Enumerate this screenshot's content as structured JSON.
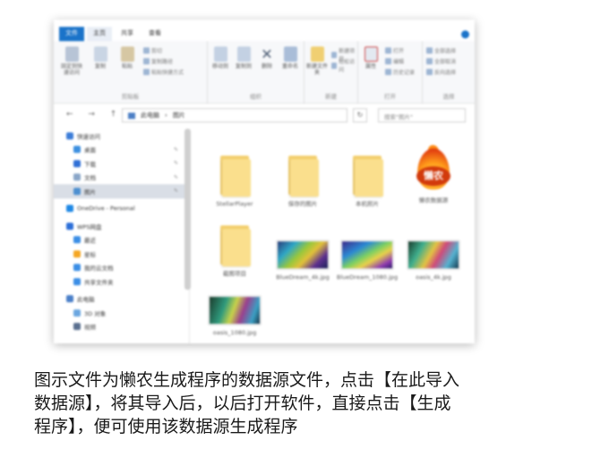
{
  "window": {
    "tabs": [
      "文件",
      "主页",
      "共享",
      "查看"
    ],
    "ribbon_groups": [
      {
        "label": "剪贴板",
        "buttons": [
          "固定到快速访问",
          "复制",
          "粘贴"
        ],
        "small": [
          "剪切",
          "复制路径",
          "粘贴快捷方式"
        ]
      },
      {
        "label": "组织",
        "buttons": [
          "移动到",
          "复制到",
          "删除",
          "重命名"
        ]
      },
      {
        "label": "新建",
        "buttons": [
          "新建文件夹"
        ],
        "small": [
          "新建项目",
          "轻松访问"
        ]
      },
      {
        "label": "打开",
        "buttons": [
          "属性"
        ],
        "small": [
          "打开",
          "编辑",
          "历史记录"
        ]
      },
      {
        "label": "选择",
        "small": [
          "全部选择",
          "全部取消",
          "反向选择"
        ]
      }
    ],
    "address": {
      "path": [
        "此电脑",
        "图片"
      ],
      "refresh": "↻",
      "search_placeholder": "搜索\"图片\""
    },
    "nav_arrows": "← → ↑",
    "sidebar": [
      {
        "label": "快速访问",
        "color": "#3c7dd8"
      },
      {
        "label": "桌面",
        "color": "#3c8fe0",
        "pin": true
      },
      {
        "label": "下载",
        "color": "#2f6fd6",
        "pin": true
      },
      {
        "label": "文档",
        "color": "#8aa6c8",
        "pin": true
      },
      {
        "label": "图片",
        "color": "#4d8fd0",
        "pin": true,
        "selected": true
      },
      {
        "label": "OneDrive - Personal",
        "color": "#1e88e5",
        "spacer": true
      },
      {
        "label": "WPS网盘",
        "color": "#2d6fd8",
        "spacer": true
      },
      {
        "label": "最近",
        "color": "#3b8ee6"
      },
      {
        "label": "星标",
        "color": "#f5a623"
      },
      {
        "label": "我的云文档",
        "color": "#3b8ee6"
      },
      {
        "label": "共享文件夹",
        "color": "#3b8ee6"
      },
      {
        "label": "此电脑",
        "color": "#4a7fc8",
        "spacer": true
      },
      {
        "label": "3D 对象",
        "color": "#6aa6e0"
      },
      {
        "label": "视频",
        "color": "#5a6f8f"
      }
    ],
    "files": [
      {
        "name": "StellarPlayer",
        "kind": "folder"
      },
      {
        "name": "保存的图片",
        "kind": "folder"
      },
      {
        "name": "本机照片",
        "kind": "folder"
      },
      {
        "name": "懒农数据源",
        "kind": "logo",
        "logo_text": "懒农"
      },
      {
        "name": "截图项目",
        "kind": "folder"
      },
      {
        "name": "BlueDream_4k.jpg",
        "kind": "image",
        "style": "g1"
      },
      {
        "name": "BlueDream_1080.jpg",
        "kind": "image",
        "style": "g2"
      },
      {
        "name": "oasis_4k.jpg",
        "kind": "image",
        "style": "g3"
      },
      {
        "name": "oasis_1080.jpg",
        "kind": "image",
        "style": "g4"
      }
    ]
  },
  "caption": {
    "line1": "图示文件为懒农生成程序的数据源文件，点击【在此导入",
    "line2": "数据源】，将其导入后，以后打开软件，直接点击【生成",
    "line3": "程序】，便可使用该数据源生成程序"
  }
}
